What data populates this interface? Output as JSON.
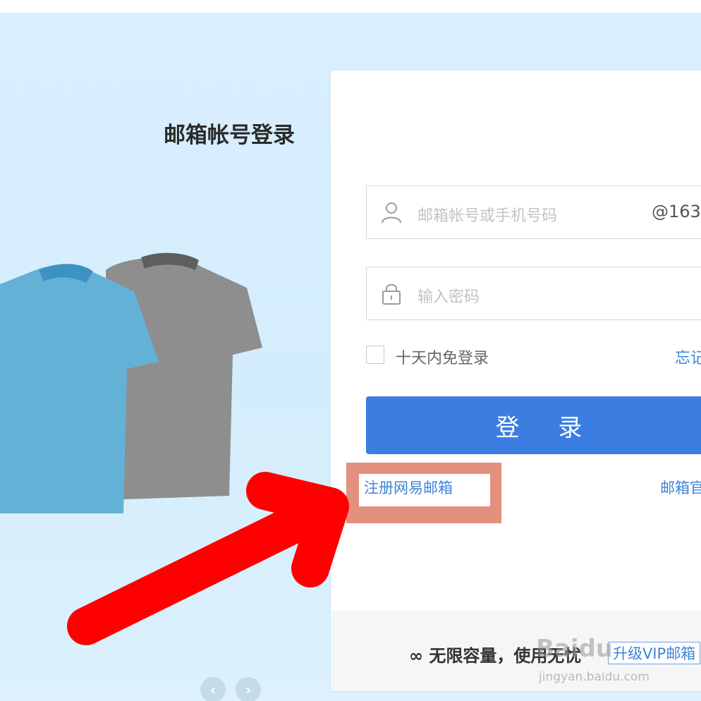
{
  "login": {
    "title": "邮箱帐号登录",
    "account_placeholder": "邮箱帐号或手机号码",
    "domain_suffix": "@163",
    "password_placeholder": "输入密码",
    "remember_label": "十天内免登录",
    "forgot_label": "忘记",
    "submit_label": "登 录",
    "register_label": "注册网易邮箱",
    "vip_label": "邮箱官"
  },
  "footer": {
    "text": "∞ 无限容量，使用无忧",
    "tag": "升级VIP邮箱"
  },
  "watermark": {
    "logo": "Baidu",
    "url": "jingyan.baidu.com"
  },
  "carousel": {
    "prev": "‹",
    "next": "›"
  },
  "icons": [
    "user-icon",
    "lock-icon",
    "prev-arrow-icon",
    "next-arrow-icon",
    "annotation-arrow"
  ],
  "colors": {
    "accent": "#3b7de0",
    "link": "#3e84d8",
    "highlight": "#e3907f",
    "annotation_arrow": "#ff0000",
    "hero_bg": "#d6eefc"
  }
}
